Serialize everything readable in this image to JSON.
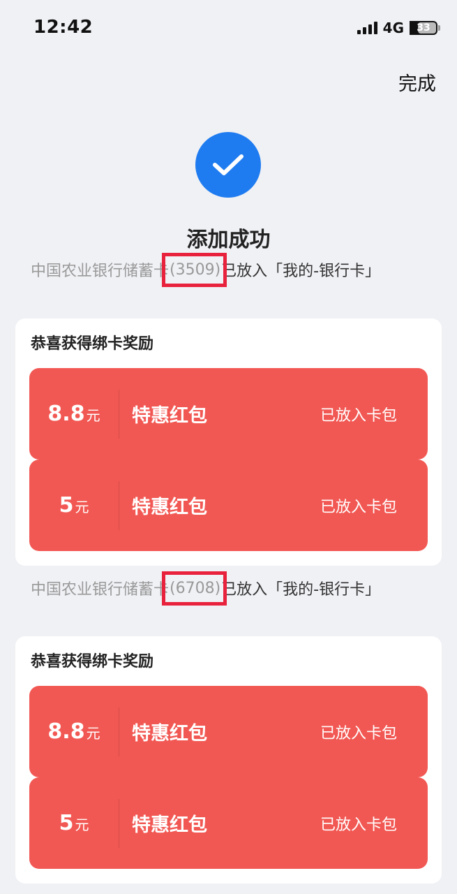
{
  "status_bar": {
    "time": "12:42",
    "network": "4G",
    "battery": "33"
  },
  "header": {
    "done_label": "完成"
  },
  "success": {
    "title": "添加成功"
  },
  "bindings": [
    {
      "bank_name": "中国农业银行储蓄卡",
      "card_number": "(3509)",
      "message_suffix": "已放入「我的-银行卡」",
      "reward_title": "恭喜获得绑卡奖励",
      "coupons": [
        {
          "amount": "8.8",
          "unit": "元",
          "name": "特惠红包",
          "status": "已放入卡包"
        },
        {
          "amount": "5",
          "unit": "元",
          "name": "特惠红包",
          "status": "已放入卡包"
        }
      ]
    },
    {
      "bank_name": "中国农业银行储蓄卡",
      "card_number": "(6708)",
      "message_suffix": "已放入「我的-银行卡」",
      "reward_title": "恭喜获得绑卡奖励",
      "coupons": [
        {
          "amount": "8.8",
          "unit": "元",
          "name": "特惠红包",
          "status": "已放入卡包"
        },
        {
          "amount": "5",
          "unit": "元",
          "name": "特惠红包",
          "status": "已放入卡包"
        }
      ]
    }
  ],
  "colors": {
    "accent_blue": "#1f7cf0",
    "coupon_red": "#f25853",
    "highlight_box": "#e8223c"
  }
}
